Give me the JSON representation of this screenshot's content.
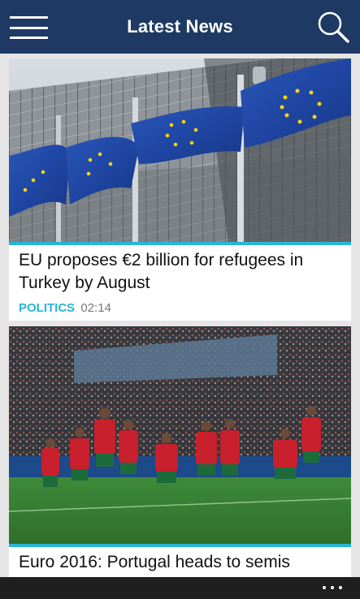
{
  "header": {
    "title": "Latest News",
    "menu_icon": "hamburger-menu-icon",
    "search_icon": "search-icon",
    "background": "#1e3a64"
  },
  "articles": [
    {
      "headline": "EU proposes €2 billion for refugees in Turkey by August",
      "category": "POLITICS",
      "time": "02:14",
      "image": "photo of EU flags in front of a building"
    },
    {
      "headline": "Euro 2016: Portugal heads to semis",
      "image": "photo of Portugal football players celebrating on pitch"
    }
  ],
  "app_bar": {
    "more_icon": "more-ellipsis-icon"
  },
  "colors": {
    "accent": "#27b6d6",
    "header": "#1e3a64",
    "app_bar": "#1f1f1f"
  }
}
